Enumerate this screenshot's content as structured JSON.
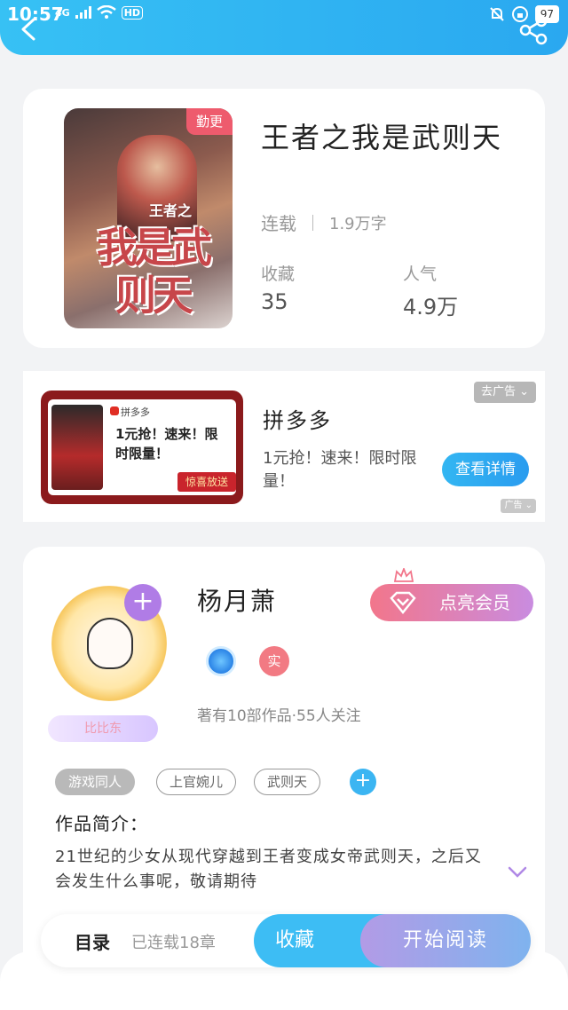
{
  "status_bar": {
    "time": "10:57",
    "network": "4G",
    "hd": "HD",
    "battery": "97"
  },
  "book": {
    "badge": "勤更",
    "cover_title": "我是武则天",
    "cover_subtitle": "王者之",
    "title": "王者之我是武则天",
    "status": "连载",
    "word_count": "1.9万字",
    "favorites_label": "收藏",
    "favorites_value": "35",
    "popularity_label": "人气",
    "popularity_value": "4.9万"
  },
  "ad": {
    "close_label": "去广告",
    "image_logo": "拼多多",
    "image_text": "1元抢！速来！限时限量！",
    "image_ribbon": "惊喜放送",
    "brand": "拼多多",
    "description": "1元抢！速来！限时限量！",
    "cta": "查看详情",
    "ad_mark": "广告"
  },
  "author": {
    "name": "杨月萧",
    "avatar_tag": "比比东",
    "vip_button": "点亮会员",
    "badge_real": "实",
    "meta": "著有10部作品·55人关注",
    "tags": [
      "游戏同人",
      "上官婉儿",
      "武则天"
    ]
  },
  "intro": {
    "title": "作品简介：",
    "text": "21世纪的少女从现代穿越到王者变成女帝武则天，之后又会发生什么事呢，敬请期待"
  },
  "bottom_bar": {
    "toc": "目录",
    "chapter_count": "已连载18章",
    "favorite": "收藏",
    "start_reading": "开始阅读"
  },
  "colors": {
    "header": "#37c1f4",
    "accent_blue": "#3dbdf4",
    "badge_red": "#ee5b6d",
    "vip_gradient_start": "#f2768b",
    "vip_gradient_end": "#c98ce0"
  }
}
